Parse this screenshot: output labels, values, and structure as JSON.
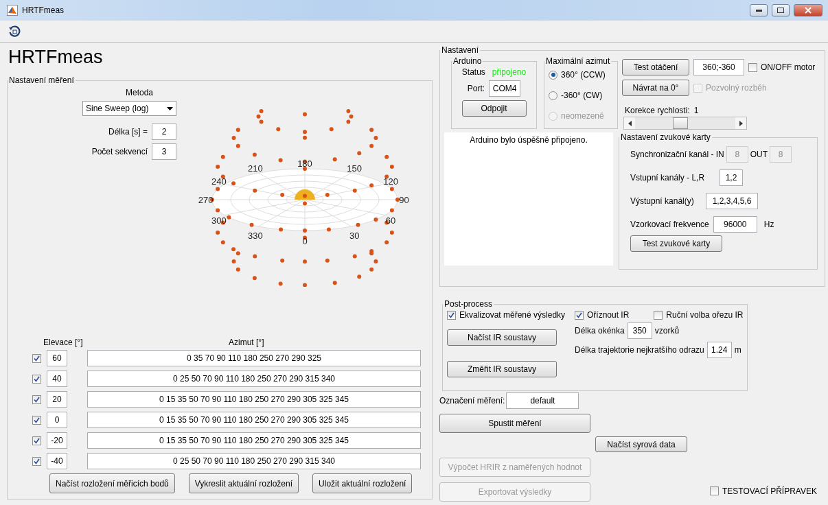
{
  "window": {
    "title": "HRTFmeas"
  },
  "app_title": "HRTFmeas",
  "measurement": {
    "legend": "Nastavení měření",
    "method_label": "Metoda",
    "method": "Sine Sweep (log)",
    "length_label": "Délka [s] =",
    "length": "2",
    "sequences_label": "Počet sekvencí",
    "sequences": "3",
    "angle_labels": [
      "0",
      "30",
      "60",
      "90",
      "120",
      "150",
      "180",
      "210",
      "240",
      "270",
      "300",
      "330"
    ],
    "elevation_header": "Elevace [°]",
    "azimuth_header": "Azimut [°]",
    "rows": [
      {
        "checked": true,
        "elevation": "60",
        "azimuths": "0 35 70 90 110 180 250 270 290 325"
      },
      {
        "checked": true,
        "elevation": "40",
        "azimuths": "0 25 50 70 90 110 180 250 270 290 315 340"
      },
      {
        "checked": true,
        "elevation": "20",
        "azimuths": "0 15 35 50 70 90 110 180 250 270 290 305 325 345"
      },
      {
        "checked": true,
        "elevation": "0",
        "azimuths": "0 15 35 50 70 90 110 180 250 270 290 305 325 345"
      },
      {
        "checked": true,
        "elevation": "-20",
        "azimuths": "0 15 35 50 70 90 110 180 250 270 290 305 325 345"
      },
      {
        "checked": true,
        "elevation": "-40",
        "azimuths": "0 25 50 70 90 110 180 250 270 290 315 340"
      }
    ],
    "buttons": [
      "Načíst rozložení měřicích bodů",
      "Vykreslit aktuální rozložení",
      "Uložit aktuální rozložení"
    ]
  },
  "settings": {
    "legend": "Nastavení",
    "arduino": {
      "legend": "Arduino",
      "status_label": "Status",
      "status": "připojeno",
      "port_label": "Port:",
      "port": "COM4",
      "button": "Odpojit"
    },
    "azimuth": {
      "legend": "Maximální azimut",
      "options": [
        {
          "label": "360° (CCW)",
          "selected": true,
          "disabled": false
        },
        {
          "label": "-360° (CW)",
          "selected": false,
          "disabled": false
        },
        {
          "label": "neomezeně",
          "selected": false,
          "disabled": true
        }
      ]
    },
    "rotation_test": "Test otáčení",
    "rotation_range": "360;-360",
    "motor": {
      "label": "ON/OFF motor",
      "checked": false,
      "disabled": false
    },
    "return_button": "Návrat na 0°",
    "slow_start": {
      "label": "Pozvolný rozběh",
      "checked": false,
      "disabled": true
    },
    "speed_label": "Korekce rychlosti:",
    "speed_value": "1",
    "speed": {
      "level": 0.44
    },
    "log": "Arduino bylo úspěšně připojeno.",
    "sound_card": {
      "legend": "Nastavení zvukové karty",
      "sync_label": "Synchronizační kanál - IN",
      "sync_in": "8",
      "out_label": "OUT",
      "sync_out": "8",
      "sync_disabled": true,
      "input_label": "Vstupní kanály - L,R",
      "input": "1,2",
      "output_label": "Výstupní kanál(y)",
      "output": "1,2,3,4,5,6",
      "rate_label": "Vzorkovací frekvence",
      "rate": "96000",
      "rate_unit": "Hz",
      "button": "Test zvukové karty"
    }
  },
  "postprocess": {
    "legend": "Post-process",
    "equalize": {
      "label": "Ekvalizovat měřené výsledky",
      "checked": true,
      "disabled": false
    },
    "trim": {
      "label": "Oříznout IR",
      "checked": true,
      "disabled": false
    },
    "manual": {
      "label": "Ruční volba ořezu IR",
      "checked": false,
      "disabled": false
    },
    "load_button": "Načíst IR soustavy",
    "measure_button": "Změřit IR soustavy",
    "window_label": "Délka okénka",
    "window": "350",
    "window_unit": "vzorků",
    "path_label": "Délka trajektorie nejkratšího odrazu",
    "path": "1.24",
    "path_unit": "m"
  },
  "label_label": "Označení měření:",
  "label": "default",
  "actions": [
    {
      "label": "Spustit měření",
      "disabled": false,
      "kind": "main"
    },
    {
      "label": "Načíst syrová data",
      "disabled": false,
      "kind": "raw"
    },
    {
      "label": "Výpočet HRIR z naměřených hodnot",
      "disabled": true,
      "kind": "main"
    },
    {
      "label": "Exportovat výsledky",
      "disabled": true,
      "kind": "main"
    }
  ],
  "test_fixture": {
    "label": "TESTOVACÍ PŘÍPRAVEK",
    "checked": false,
    "disabled": false
  }
}
